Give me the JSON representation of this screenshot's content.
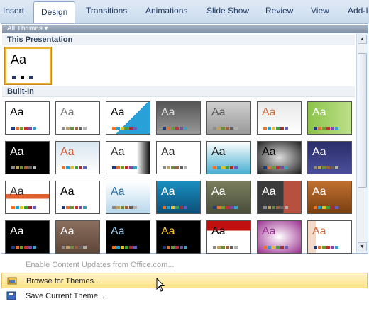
{
  "ribbon": {
    "tabs": [
      "Insert",
      "Design",
      "Transitions",
      "Animations",
      "Slide Show",
      "Review",
      "View",
      "Add-I"
    ],
    "active": "Design"
  },
  "gallery": {
    "filter_label": "All Themes ▾",
    "section_this": "This Presentation",
    "section_builtin": "Built-In",
    "thumb_text": "Aa"
  },
  "menu": {
    "enable_updates": "Enable Content Updates from Office.com...",
    "browse": "Browse for Themes...",
    "save": "Save Current Theme..."
  },
  "colors": {
    "accent_hover": "#ffe38a",
    "selected_border": "#e8b23a"
  }
}
